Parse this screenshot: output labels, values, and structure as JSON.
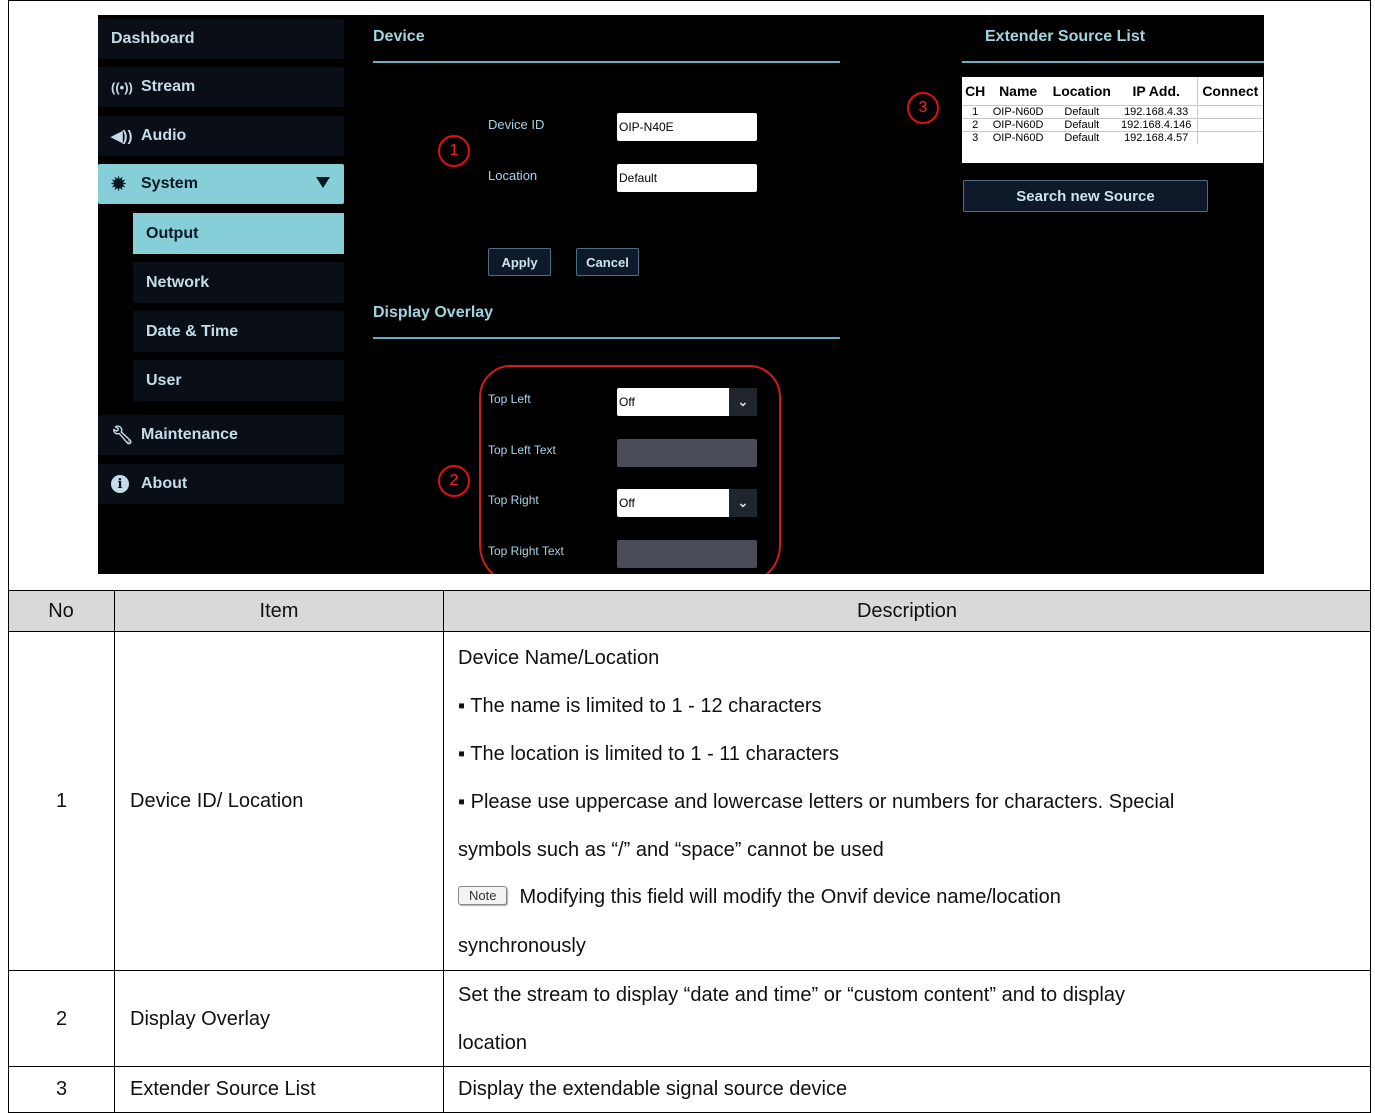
{
  "sidebar": {
    "dashboard": "Dashboard",
    "stream": "Stream",
    "audio": "Audio",
    "system": "System",
    "output": "Output",
    "network": "Network",
    "date_time": "Date & Time",
    "user": "User",
    "maintenance": "Maintenance",
    "about": "About"
  },
  "device": {
    "title": "Device",
    "device_id_label": "Device ID",
    "device_id_value": "OIP-N40E",
    "location_label": "Location",
    "location_value": "Default",
    "apply": "Apply",
    "cancel": "Cancel"
  },
  "overlay": {
    "title": "Display Overlay",
    "top_left_label": "Top Left",
    "top_left_value": "Off",
    "top_left_text_label": "Top Left Text",
    "top_right_label": "Top Right",
    "top_right_value": "Off",
    "top_right_text_label": "Top Right Text"
  },
  "extender": {
    "title": "Extender Source List",
    "columns": [
      "CH",
      "Name",
      "Location",
      "IP Add.",
      "Connect"
    ],
    "rows": [
      [
        "1",
        "OIP-N60D",
        "Default",
        "192.168.4.33",
        ""
      ],
      [
        "2",
        "OIP-N60D",
        "Default",
        "192.168.4.146",
        ""
      ],
      [
        "3",
        "OIP-N60D",
        "Default",
        "192.168.4.57",
        ""
      ]
    ],
    "search_button": "Search new Source"
  },
  "callouts": [
    "1",
    "2",
    "3"
  ],
  "table": {
    "headers": {
      "no": "No",
      "item": "Item",
      "description": "Description"
    },
    "row1": {
      "no": "1",
      "item": "Device ID/ Location",
      "lines": [
        "Device Name/Location",
        "▪ The name is limited to 1 - 12 characters",
        "▪ The location is limited to 1 - 11 characters",
        "▪ Please use uppercase and lowercase letters or numbers for characters. Special",
        "symbols such as “/” and “space” cannot be used"
      ],
      "note_badge": "Note",
      "note_text": "Modifying this field will modify the Onvif device name/location",
      "note_cont": "synchronously"
    },
    "row2": {
      "no": "2",
      "item": "Display Overlay",
      "line1": "Set the stream to display “date and time” or “custom content” and to display",
      "line2": "location"
    },
    "row3": {
      "no": "3",
      "item": "Extender Source List",
      "line1": "Display the extendable signal source device"
    }
  },
  "colors": {
    "nav_active": "#86cfd8",
    "accent_text": "#9fd4e0",
    "callout_red": "#e01010",
    "header_bg": "#d9d9d9"
  }
}
